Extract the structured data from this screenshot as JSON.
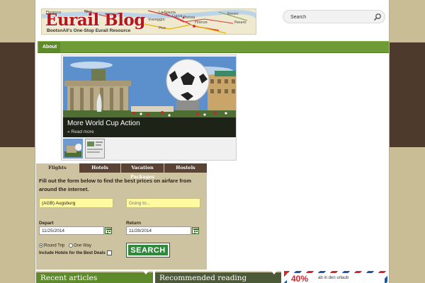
{
  "colors": {
    "background_tan": "#c9bd96",
    "background_brown": "#4d3a2d",
    "nav_green": "#6f9a36",
    "widget_tan": "#cdc3a0",
    "tab_brown": "#5a4234",
    "search_button_green": "#2e8a3a",
    "input_yellow": "#fffaa0"
  },
  "header": {
    "logo_title": "Eurail Blog",
    "logo_tagline": "BootsnAll's One-Stop Eurail Resource",
    "map_labels": [
      "Florence",
      "Nice",
      "La Spezia",
      "Lucca",
      "Pistoia",
      "Viareggio",
      "Pisa",
      "Firenze",
      "Rimini",
      "Pesaro"
    ],
    "search_placeholder": "Search",
    "search_icon": "magnifier-icon"
  },
  "nav": {
    "items": [
      {
        "label": "About"
      }
    ]
  },
  "slideshow": {
    "title": "More World Cup Action",
    "read_more": "» Read more",
    "thumbnail_count": 2
  },
  "flight_widget": {
    "tabs": [
      {
        "label": "Flights",
        "active": true
      },
      {
        "label": "Hotels",
        "active": false
      },
      {
        "label": "Vacation Packages",
        "active": false
      },
      {
        "label": "Hostels",
        "active": false
      }
    ],
    "intro": "Fill out the form below to find the best prices on airfare from around the internet.",
    "from_value": "(AGB) Augsburg",
    "to_placeholder": "Going to...",
    "depart_label": "Depart",
    "depart_value": "11/25/2014",
    "return_label": "Return",
    "return_value": "11/28/2014",
    "round_trip_label": "Round Trip",
    "one_way_label": "One Way",
    "round_trip_selected": true,
    "include_hotels_label": "Include Hotels for the Best Deals",
    "include_hotels_checked": false,
    "search_button": "SEARCH"
  },
  "bottom_blocks": {
    "recent_articles": "Recent articles",
    "recommended_reading": "Recommended reading",
    "ad_percent": "40%",
    "ad_text": "ab in den urlaub"
  }
}
